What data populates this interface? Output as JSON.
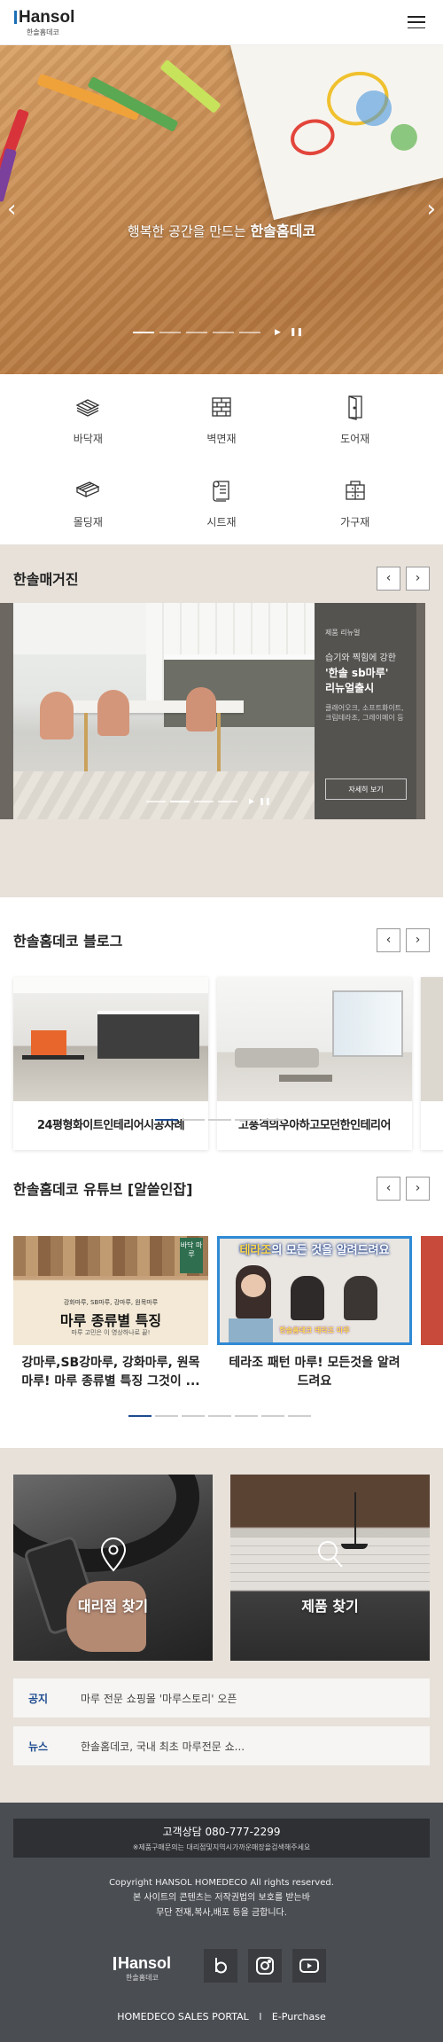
{
  "header": {
    "logo_text": "Hansol",
    "logo_sub": "한솔홈데코"
  },
  "hero": {
    "caption_prefix": "행복한 공간을 만드는",
    "caption_brand": "한솔홈데코",
    "prev_icon": "chevron-left-icon",
    "next_icon": "chevron-right-icon",
    "play_label": "▶",
    "pause_label": "❚❚"
  },
  "categories": [
    {
      "label": "바닥재",
      "icon": "floor-layers-icon"
    },
    {
      "label": "벽면재",
      "icon": "wall-panel-icon"
    },
    {
      "label": "도어재",
      "icon": "door-icon"
    },
    {
      "label": "몰딩재",
      "icon": "molding-icon"
    },
    {
      "label": "시트재",
      "icon": "sheet-roll-icon"
    },
    {
      "label": "가구재",
      "icon": "furniture-icon"
    }
  ],
  "magazine": {
    "title": "한솔매거진",
    "tag": "제품 리뉴얼",
    "desc1": "습기와 찍힘에 강한",
    "desc2a": "'한솔 sb마루'",
    "desc2b": "리뉴얼출시",
    "desc3a": "클래어오크, 소프트화이트,",
    "desc3b": "크림테라조, 그레이메이 등",
    "more": "자세히 보기",
    "play_label": "▶",
    "pause_label": "❚❚"
  },
  "blog": {
    "title": "한솔홈데코 블로그",
    "cards": [
      {
        "title": "24평형화이트인테리어시공사례"
      },
      {
        "title": "고풍격의우아하고모던한인테리어"
      }
    ]
  },
  "youtube": {
    "title": "한솔홈데코 유튜브 [알쓸인잡]",
    "cards": [
      {
        "line1": "강마루,SB강마루, 강화마루, 원목",
        "line2": "마루! 마루 종류별 특징 그것이 ...",
        "thumb_small": "강화마루, SB마루, 강마루, 원목마루",
        "thumb_big": "마루 종류별 특징",
        "thumb_sub": "마루 고민은 이 영상하나로 끝!",
        "thumb_tag": "바닥 마루"
      },
      {
        "line1": "테라조 패턴 마루! 모든것을 알려",
        "line2": "드려요",
        "thumb_top_brand": "테라조",
        "thumb_top_rest": "의 모든 것을 알려드려요",
        "thumb_bottom": "한솔홈데코 테라조 마루"
      }
    ]
  },
  "find": {
    "dealer": "대리점 찾기",
    "product": "제품 찾기"
  },
  "notices": [
    {
      "kind": "공지",
      "text": "마루 전문 쇼핑몰 '마루스토리' 오픈"
    },
    {
      "kind": "뉴스",
      "text": "한솔홈데코, 국내 최초 마루전문 쇼..."
    }
  ],
  "footer": {
    "cs_line": "고객상담 080-777-2299",
    "cs_note": "※제품구매문의는 대리점및지역시가까운매장을검색해주세요",
    "copy1": "Copyright HANSOL HOMEDECO All rights reserved.",
    "copy2": "본 사이트의 콘텐츠는 저작권법의 보호를 받는바",
    "copy3": "무단 전재,복사,배포 등을 금합니다.",
    "logo_text": "Hansol",
    "logo_sub": "한솔홈데코",
    "links": [
      "HOMEDECO SALES PORTAL",
      "E-Purchase"
    ],
    "link_sep": "l",
    "sns": [
      "blog-b-icon",
      "instagram-icon",
      "youtube-icon"
    ]
  }
}
